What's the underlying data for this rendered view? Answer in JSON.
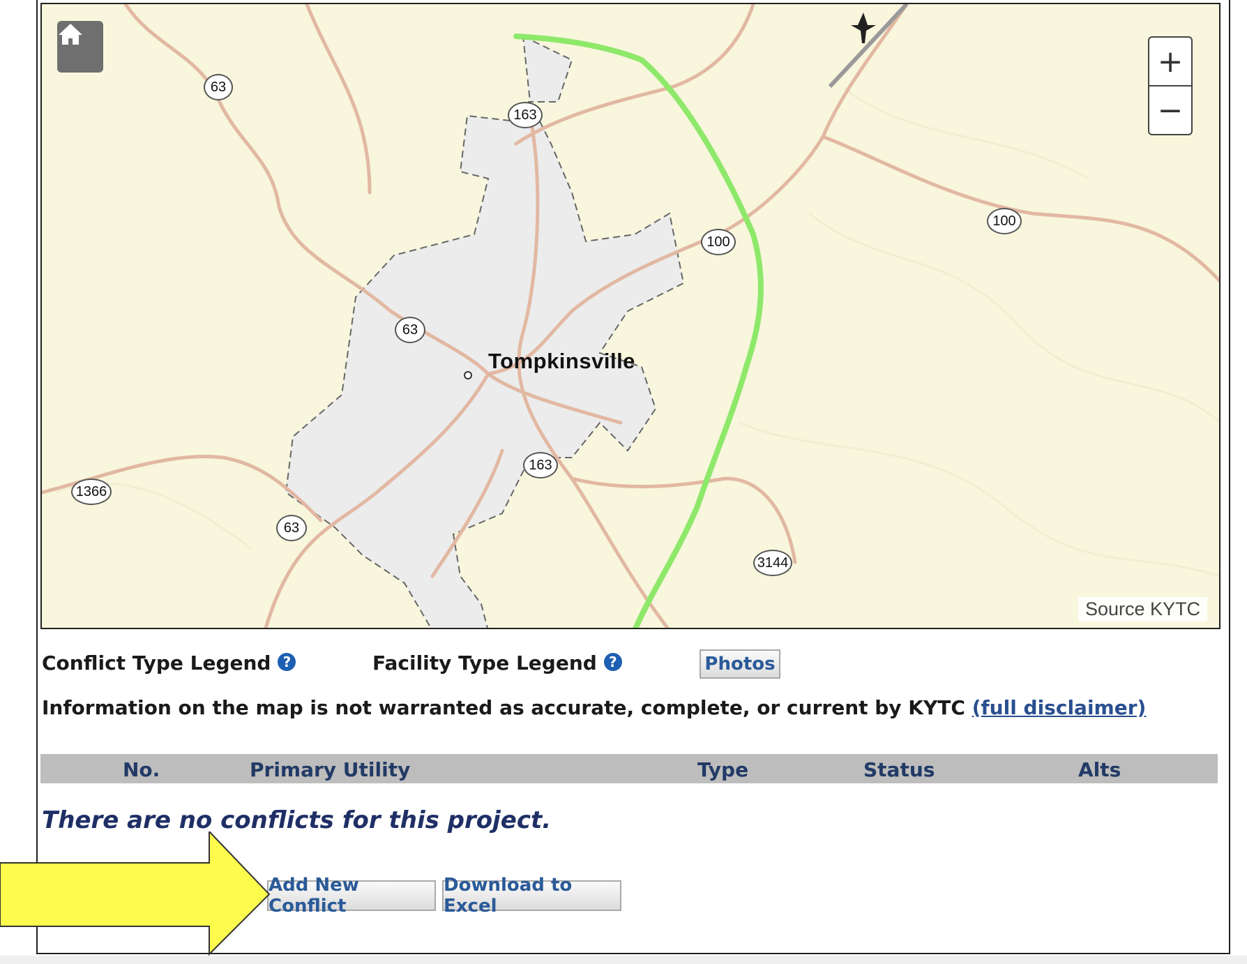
{
  "map": {
    "city_label": "Tompkinsville",
    "source_label": "Source KYTC",
    "zoom_in_label": "+",
    "zoom_out_label": "−",
    "shields": [
      "63",
      "163",
      "100",
      "100",
      "63",
      "163",
      "1366",
      "63",
      "3144"
    ],
    "colors": {
      "background": "#f8f6dc",
      "city_area": "#ececec",
      "road": "#e2b8a2",
      "project_line": "#8ee86a"
    }
  },
  "legend": {
    "conflict_type_label": "Conflict Type Legend",
    "facility_type_label": "Facility Type Legend",
    "help_icon_glyph": "?",
    "photos_button": "Photos"
  },
  "disclaimer": {
    "text": "Information on the map is not warranted as accurate, complete, or current by KYTC",
    "link_text": "(full disclaimer)"
  },
  "table": {
    "columns": [
      "No.",
      "Primary Utility",
      "Type",
      "Status",
      "Alts"
    ],
    "empty_message": "There are no conflicts for this project."
  },
  "actions": {
    "add_conflict": "Add New Conflict",
    "download_excel": "Download to Excel"
  },
  "annotation": {
    "arrow_color": "#fdfc4d"
  }
}
